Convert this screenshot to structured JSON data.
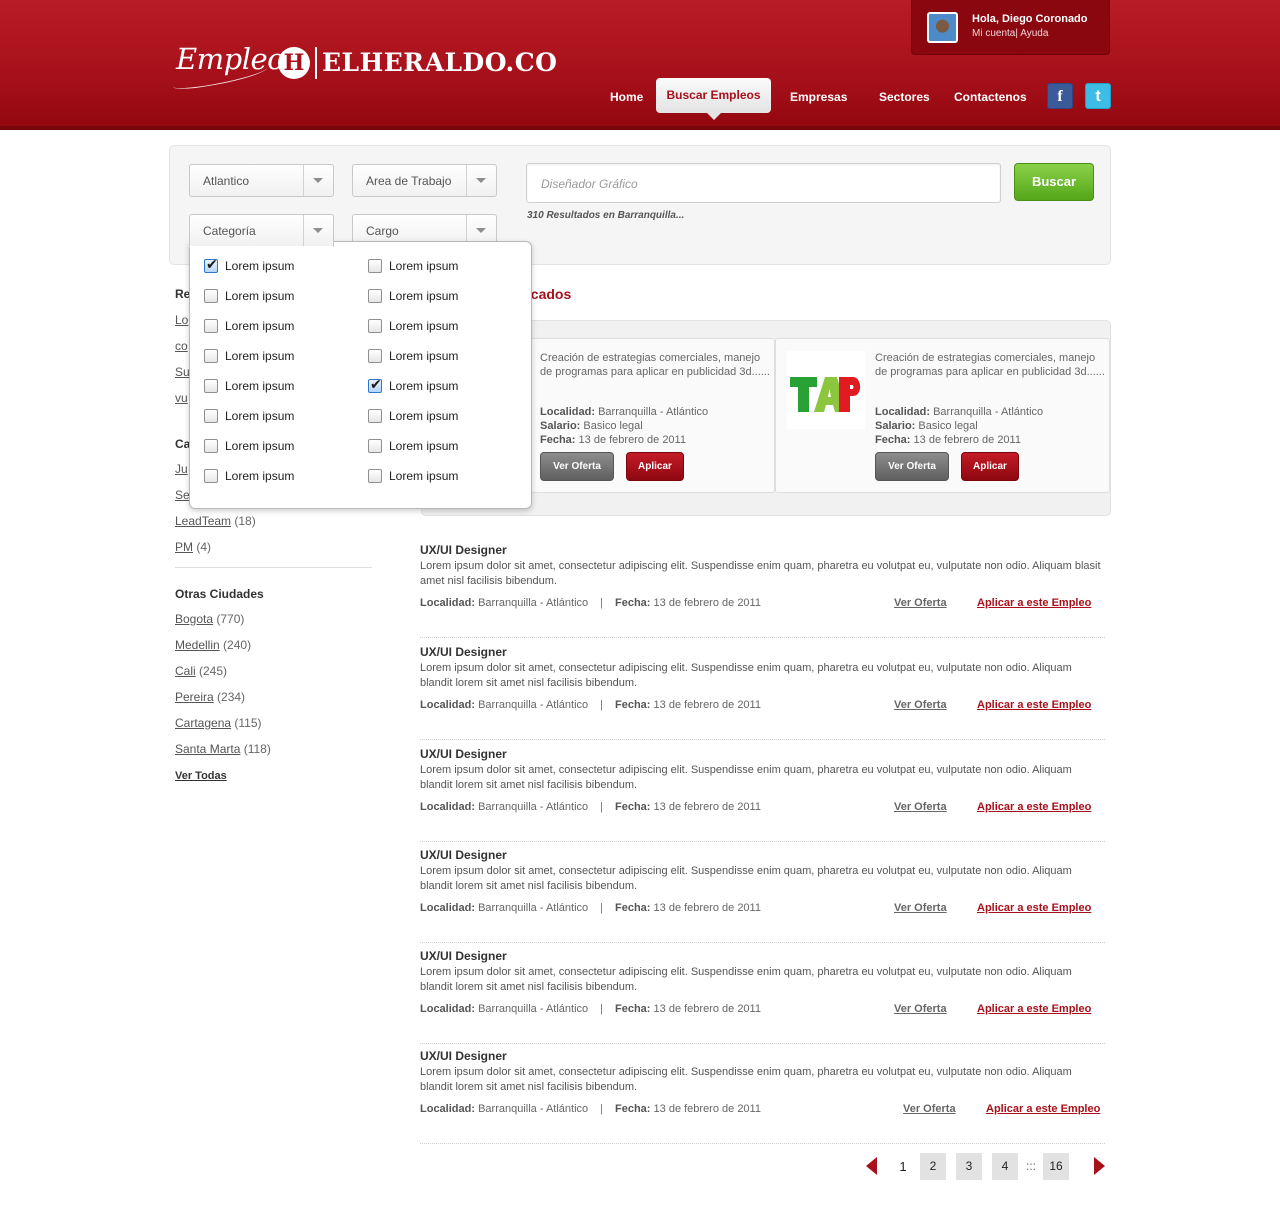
{
  "header": {
    "logo_script": "Empleos",
    "logo_mark": "H",
    "logo_text": "ELHERALDO.CO",
    "user_greeting": "Hola, Diego Coronado",
    "user_links": [
      "Mi cuenta",
      "Ayuda"
    ],
    "nav": [
      "Home",
      "Buscar Empleos",
      "Empresas",
      "Sectores",
      "Contactenos"
    ],
    "active_nav": "Buscar Empleos",
    "social": {
      "facebook": "f",
      "twitter": "t"
    }
  },
  "search": {
    "selects": [
      "Atlantico",
      "Area de Trabajo",
      "Categoría",
      "Cargo"
    ],
    "query": "Diseñador Gráfico",
    "button": "Buscar",
    "results": "310 Resultados en Barranquilla..."
  },
  "dropdown": {
    "left": [
      {
        "label": "Lorem ipsum",
        "checked": true
      },
      {
        "label": "Lorem ipsum",
        "checked": false
      },
      {
        "label": "Lorem ipsum",
        "checked": false
      },
      {
        "label": "Lorem ipsum",
        "checked": false
      },
      {
        "label": "Lorem ipsum",
        "checked": false
      },
      {
        "label": "Lorem ipsum",
        "checked": false
      },
      {
        "label": "Lorem ipsum",
        "checked": false
      },
      {
        "label": "Lorem ipsum",
        "checked": false
      }
    ],
    "right": [
      {
        "label": "Lorem ipsum",
        "checked": false
      },
      {
        "label": "Lorem ipsum",
        "checked": false
      },
      {
        "label": "Lorem ipsum",
        "checked": false
      },
      {
        "label": "Lorem ipsum",
        "checked": false
      },
      {
        "label": "Lorem ipsum",
        "checked": true
      },
      {
        "label": "Lorem ipsum",
        "checked": false
      },
      {
        "label": "Lorem ipsum",
        "checked": false
      },
      {
        "label": "Lorem ipsum",
        "checked": false
      }
    ]
  },
  "sidebar": {
    "section1_heading": "Re",
    "section1_links": [
      "Lo",
      "co",
      "Su",
      "vu"
    ],
    "section2_heading": "Ca",
    "section2_links": [
      {
        "name": "Ju",
        "count": ""
      },
      {
        "name": "Se",
        "count": ""
      },
      {
        "name": "LeadTeam",
        "count": "(18)"
      },
      {
        "name": "PM",
        "count": "(4)"
      }
    ],
    "cities_heading": "Otras Ciudades",
    "cities": [
      {
        "name": "Bogota",
        "count": "(770)"
      },
      {
        "name": "Medellin",
        "count": "(240)"
      },
      {
        "name": "Cali",
        "count": " (245)"
      },
      {
        "name": "Pereira",
        "count": "(234)"
      },
      {
        "name": "Cartagena",
        "count": "(115)"
      },
      {
        "name": "Santa Marta",
        "count": "(118)"
      }
    ],
    "see_all": "Ver Todas"
  },
  "featured": {
    "title": "acados",
    "cards": [
      {
        "logo": "",
        "description": "Creación de estrategias comerciales, manejo de programas para aplicar en publicidad 3d......",
        "localidad_label": "Localidad:",
        "localidad": "Barranquilla - Atlántico",
        "salario_label": "Salario:",
        "salario": "Basico legal",
        "fecha_label": "Fecha:",
        "fecha": "13 de febrero de 2011",
        "ver_label": "Ver Oferta",
        "aplicar_label": "Aplicar"
      },
      {
        "logo": "TAP",
        "description": "Creación de estrategias comerciales, manejo de programas para aplicar en publicidad 3d......",
        "localidad_label": "Localidad:",
        "localidad": "Barranquilla - Atlántico",
        "salario_label": "Salario:",
        "salario": "Basico legal",
        "fecha_label": "Fecha:",
        "fecha": "13 de febrero de 2011",
        "ver_label": "Ver Oferta",
        "aplicar_label": "Aplicar"
      }
    ]
  },
  "jobs": [
    {
      "title": "UX/UI Designer",
      "body": "Lorem ipsum dolor sit amet, consectetur adipiscing elit. Suspendisse enim quam, pharetra eu volutpat eu, vulputate non odio. Aliquam blasit amet nisl facilisis bibendum.",
      "localidad_label": "Localidad:",
      "localidad": "Barranquilla - Atlántico",
      "sep": "|",
      "fecha_label": "Fecha:",
      "fecha": "13 de febrero de 2011",
      "ver": "Ver  Oferta",
      "aplicar": "Aplicar a este Empleo"
    },
    {
      "title": "UX/UI Designer",
      "body": "Lorem ipsum dolor sit amet, consectetur adipiscing elit. Suspendisse enim quam, pharetra eu volutpat eu, vulputate non odio. Aliquam blandit lorem sit amet nisl facilisis bibendum.",
      "localidad_label": "Localidad:",
      "localidad": "Barranquilla - Atlántico",
      "sep": "|",
      "fecha_label": "Fecha:",
      "fecha": "13 de febrero de 2011",
      "ver": "Ver  Oferta",
      "aplicar": "Aplicar a este Empleo"
    },
    {
      "title": "UX/UI Designer",
      "body": "Lorem ipsum dolor sit amet, consectetur adipiscing elit. Suspendisse enim quam, pharetra eu volutpat eu, vulputate non odio. Aliquam blandit lorem sit amet nisl facilisis bibendum.",
      "localidad_label": "Localidad:",
      "localidad": "Barranquilla - Atlántico",
      "sep": "|",
      "fecha_label": "Fecha:",
      "fecha": "13 de febrero de 2011",
      "ver": "Ver  Oferta",
      "aplicar": "Aplicar a este Empleo"
    },
    {
      "title": "UX/UI Designer",
      "body": "Lorem ipsum dolor sit amet, consectetur adipiscing elit. Suspendisse enim quam, pharetra eu volutpat eu, vulputate non odio. Aliquam blandit lorem sit amet nisl facilisis bibendum.",
      "localidad_label": "Localidad:",
      "localidad": "Barranquilla - Atlántico",
      "sep": "|",
      "fecha_label": "Fecha:",
      "fecha": "13 de febrero de 2011",
      "ver": "Ver  Oferta",
      "aplicar": "Aplicar a este Empleo"
    },
    {
      "title": "UX/UI Designer",
      "body": "Lorem ipsum dolor sit amet, consectetur adipiscing elit. Suspendisse enim quam, pharetra eu volutpat eu, vulputate non odio. Aliquam blandit lorem sit amet nisl facilisis bibendum.",
      "localidad_label": "Localidad:",
      "localidad": "Barranquilla - Atlántico",
      "sep": "|",
      "fecha_label": "Fecha:",
      "fecha": "13 de febrero de 2011",
      "ver": "Ver  Oferta",
      "aplicar": "Aplicar a este Empleo"
    },
    {
      "title": "UX/UI Designer",
      "body": "Lorem ipsum dolor sit amet, consectetur adipiscing elit. Suspendisse enim quam, pharetra eu volutpat eu, vulputate non odio. Aliquam blandit lorem sit amet nisl facilisis bibendum.",
      "localidad_label": "Localidad:",
      "localidad": "Barranquilla - Atlántico",
      "sep": "|",
      "fecha_label": "Fecha:",
      "fecha": "13 de febrero de 2011",
      "ver": "Ver  Oferta",
      "aplicar": "Aplicar a este Empleo"
    }
  ],
  "pagination": {
    "current": "1",
    "pages": [
      "2",
      "3",
      "4"
    ],
    "dots": ":::",
    "last": "16"
  },
  "colors": {
    "brand_red": "#a8111b",
    "accent_green": "#6cbd2c",
    "tap_green": "#2aa135",
    "tap_red": "#e01b22"
  }
}
